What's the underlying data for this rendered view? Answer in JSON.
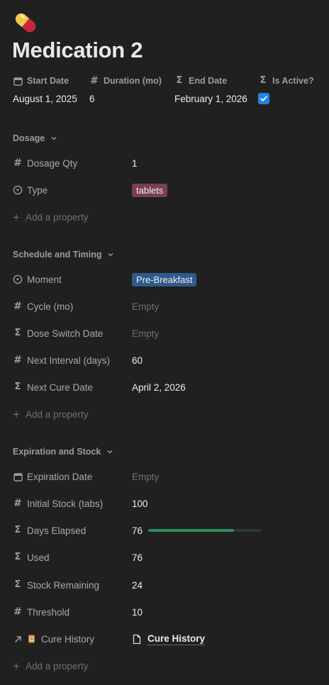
{
  "page": {
    "title": "Medication 2",
    "icon": "pill-icon"
  },
  "header_props": [
    {
      "label": "Start Date",
      "icon": "calendar-icon",
      "value": "August 1, 2025"
    },
    {
      "label": "Duration (mo)",
      "icon": "hash-icon",
      "value": "6"
    },
    {
      "label": "End Date",
      "icon": "sigma-icon",
      "value": "February 1, 2026"
    },
    {
      "label": "Is Active?",
      "icon": "sigma-icon",
      "checked": true
    }
  ],
  "sections": {
    "dosage": {
      "title": "Dosage",
      "props": {
        "dosage_qty": {
          "label": "Dosage Qty",
          "value": "1"
        },
        "type": {
          "label": "Type",
          "value": "tablets",
          "tag_color": "#7a3e55"
        }
      },
      "add_property": "Add a property"
    },
    "schedule": {
      "title": "Schedule and Timing",
      "props": {
        "moment": {
          "label": "Moment",
          "value": "Pre-Breakfast",
          "tag_color": "#2e5b8a"
        },
        "cycle": {
          "label": "Cycle (mo)",
          "value": "Empty"
        },
        "dose_switch": {
          "label": "Dose Switch Date",
          "value": "Empty"
        },
        "next_interval": {
          "label": "Next Interval (days)",
          "value": "60"
        },
        "next_cure": {
          "label": "Next Cure Date",
          "value": "April 2, 2026"
        }
      },
      "add_property": "Add a property"
    },
    "expiration": {
      "title": "Expiration and Stock",
      "props": {
        "expiration_date": {
          "label": "Expiration Date",
          "value": "Empty"
        },
        "initial_stock": {
          "label": "Initial Stock (tabs)",
          "value": "100"
        },
        "days_elapsed": {
          "label": "Days Elapsed",
          "value": "76",
          "progress_fraction": 0.76
        },
        "used": {
          "label": "Used",
          "value": "76"
        },
        "stock_remaining": {
          "label": "Stock Remaining",
          "value": "24"
        },
        "threshold": {
          "label": "Threshold",
          "value": "10"
        },
        "cure_history": {
          "label": "Cure History",
          "value": "Cure History"
        }
      },
      "add_property": "Add a property"
    }
  },
  "colors": {
    "background": "#202020",
    "checkbox": "#2383e2",
    "progress_fill": "#2f8a5b"
  }
}
